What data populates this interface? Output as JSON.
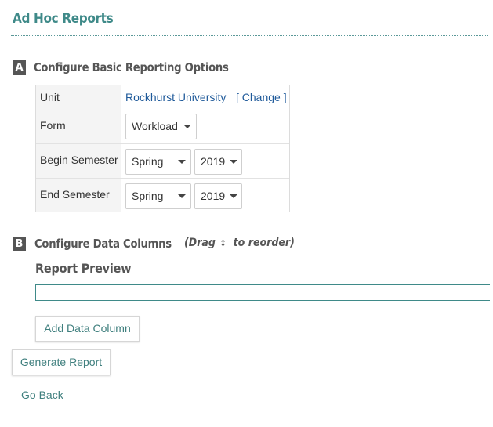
{
  "page": {
    "title": "Ad Hoc Reports"
  },
  "section_a": {
    "badge": "A",
    "heading": "Configure Basic Reporting Options",
    "unit": {
      "label": "Unit",
      "value": "Rockhurst University",
      "change_link": "[ Change ]"
    },
    "form": {
      "label": "Form",
      "selected": "Workload"
    },
    "begin_semester": {
      "label": "Begin Semester",
      "term": "Spring",
      "year": "2019"
    },
    "end_semester": {
      "label": "End Semester",
      "term": "Spring",
      "year": "2019"
    }
  },
  "section_b": {
    "badge": "B",
    "heading": "Configure Data Columns",
    "drag_hint_prefix": "(Drag",
    "drag_hint_suffix": "to reorder)",
    "drag_icon": "up-down-arrow-icon",
    "preview_title": "Report Preview",
    "add_column_label": "Add Data Column"
  },
  "actions": {
    "generate_label": "Generate Report",
    "go_back_label": "Go Back"
  },
  "colors": {
    "accent": "#3f8a89",
    "link": "#1f5a9a",
    "badge": "#555555"
  }
}
